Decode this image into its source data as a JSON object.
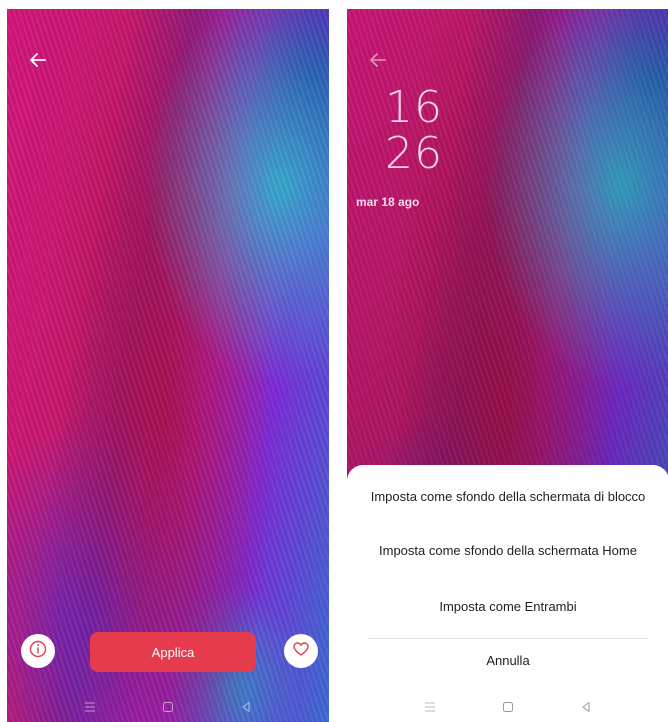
{
  "left_screen": {
    "apply_label": "Applica",
    "icons": {
      "back": "back-arrow-icon",
      "info": "info-icon",
      "favorite": "heart-icon"
    },
    "navbar": [
      "menu-icon",
      "home-square-icon",
      "back-triangle-icon"
    ]
  },
  "right_screen": {
    "lock_clock": {
      "hour": "16",
      "minute": "26",
      "date": "mar 18 ago"
    },
    "sheet": {
      "options": [
        "Imposta come sfondo della schermata di blocco",
        "Imposta come sfondo della schermata Home",
        "Imposta come Entrambi"
      ],
      "cancel": "Annulla"
    },
    "navbar": [
      "menu-icon",
      "home-square-icon",
      "back-triangle-icon"
    ]
  },
  "colors": {
    "accent": "#e63b4d",
    "sheet_background": "#ffffff",
    "sheet_text": "#1f1f1f"
  }
}
